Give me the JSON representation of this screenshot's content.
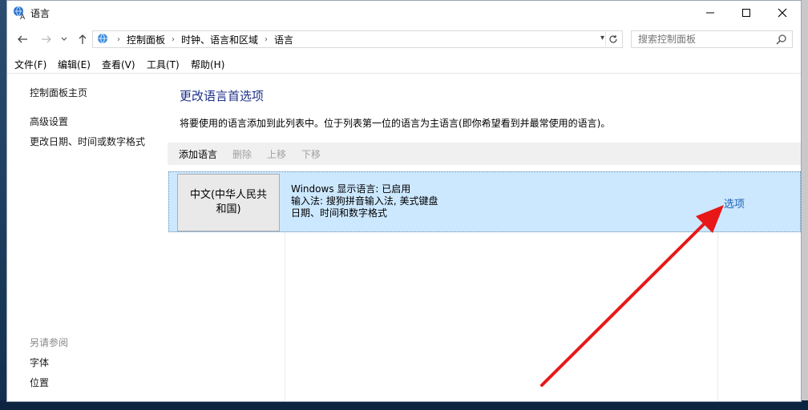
{
  "window": {
    "title": "语言"
  },
  "address": {
    "breadcrumbs": [
      "控制面板",
      "时钟、语言和区域",
      "语言"
    ]
  },
  "search": {
    "placeholder": "搜索控制面板"
  },
  "menu": [
    "文件(F)",
    "编辑(E)",
    "查看(V)",
    "工具(T)",
    "帮助(H)"
  ],
  "sidebar": {
    "home": "控制面板主页",
    "advanced": "高级设置",
    "change_formats": "更改日期、时间或数字格式",
    "see_also": "另请参阅",
    "fonts": "字体",
    "location": "位置"
  },
  "main": {
    "heading": "更改语言首选项",
    "description": "将要使用的语言添加到此列表中。位于列表第一位的语言为主语言(即你希望看到并最常使用的语言)。",
    "toolbar": {
      "add": "添加语言",
      "remove": "删除",
      "up": "上移",
      "down": "下移"
    },
    "languages": [
      {
        "name_line1": "中文(中华人民共",
        "name_line2": "和国)",
        "info1": "Windows 显示语言: 已启用",
        "info2": "输入法: 搜狗拼音输入法, 美式键盘",
        "info3": "日期、时间和数字格式",
        "options": "选项"
      }
    ]
  },
  "colors": {
    "accent": "#1e3287",
    "link": "#1e5fb4",
    "selected_row": "#cce8ff",
    "annotation_arrow": "#e81818"
  },
  "icons": [
    "language-icon",
    "minimize-icon",
    "maximize-icon",
    "close-icon",
    "back-arrow-icon",
    "forward-arrow-icon",
    "up-arrow-icon",
    "refresh-icon",
    "search-icon"
  ]
}
